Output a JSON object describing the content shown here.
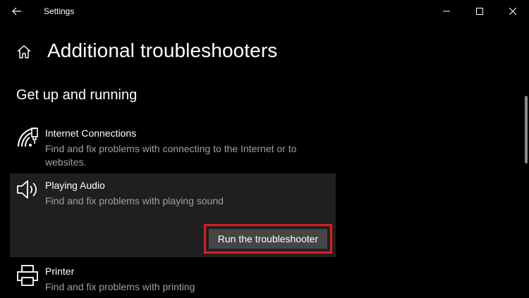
{
  "window": {
    "title": "Settings",
    "controls": {
      "back_icon": "back-arrow-icon",
      "minimize_icon": "minimize-icon",
      "maximize_icon": "maximize-icon",
      "close_icon": "close-icon"
    }
  },
  "header": {
    "title": "Additional troubleshooters",
    "home_icon": "home-icon"
  },
  "section": {
    "title": "Get up and running"
  },
  "items": [
    {
      "name": "Internet Connections",
      "description": "Find and fix problems with connecting to the Internet or to websites.",
      "icon": "wifi-network-icon"
    },
    {
      "name": "Playing Audio",
      "description": "Find and fix problems with playing sound",
      "icon": "speaker-icon",
      "button_label": "Run the troubleshooter",
      "expanded": true
    },
    {
      "name": "Printer",
      "description": "Find and fix problems with printing",
      "icon": "printer-icon"
    }
  ],
  "colors": {
    "background": "#000000",
    "selected_item_bg": "#1f1f1f",
    "button_bg": "#454545",
    "highlight_outline": "#e01b24",
    "secondary_text": "#a0a0a0"
  }
}
